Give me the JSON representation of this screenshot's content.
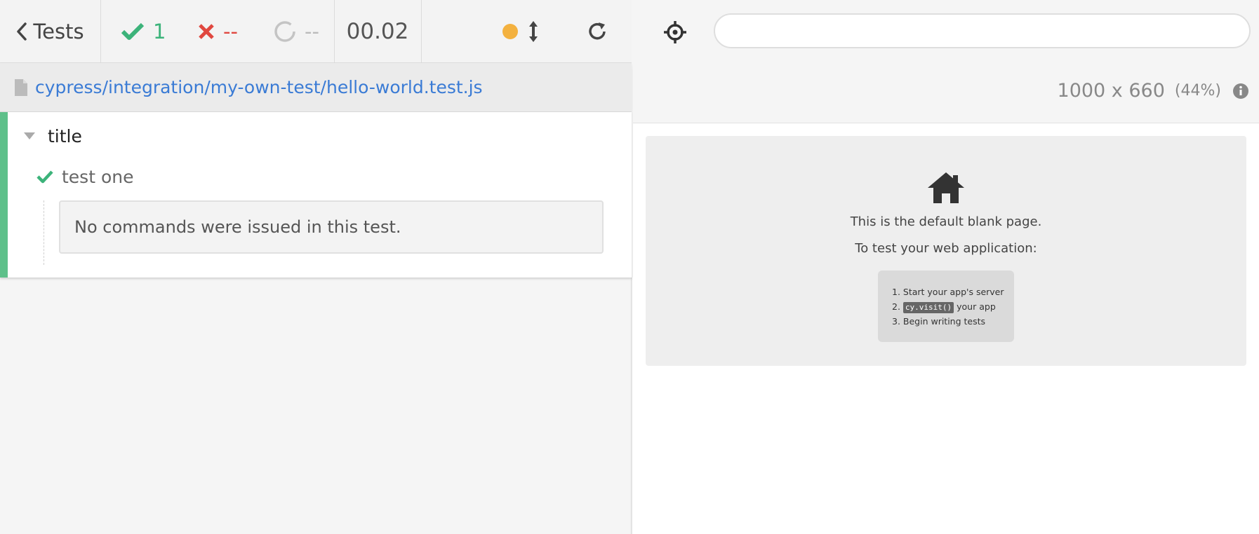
{
  "reporter": {
    "stats": {
      "back_label": "Tests",
      "passed": "1",
      "failed": "--",
      "pending": "--",
      "duration": "00.02"
    },
    "spec_path": "cypress/integration/my-own-test/hello-world.test.js",
    "suite_title": "title",
    "test_title": "test one",
    "no_commands": "No commands were issued in this test."
  },
  "aut": {
    "url": "",
    "viewport_size": "1000 x 660",
    "viewport_scale": "(44%)",
    "blank_page": {
      "line1": "This is the default blank page.",
      "line2": "To test your web application:",
      "step1": "1. Start your app's server",
      "step2_prefix": "2.",
      "step2_code": "cy.visit()",
      "step2_suffix": "your app",
      "step3": "3. Begin writing tests"
    }
  },
  "colors": {
    "passed": "#3cb37a",
    "failed": "#e0473f",
    "pending": "#bbbbbb",
    "auto_scroll_dot": "#f3b13f",
    "link": "#3a7bd5",
    "suite_stripe": "#5ec08a"
  },
  "icons": [
    "chevron-left-icon",
    "check-icon",
    "x-icon",
    "spinner-icon",
    "arrows-vertical-icon",
    "reload-icon",
    "file-icon",
    "caret-down-icon",
    "crosshairs-icon",
    "info-icon",
    "home-icon"
  ]
}
